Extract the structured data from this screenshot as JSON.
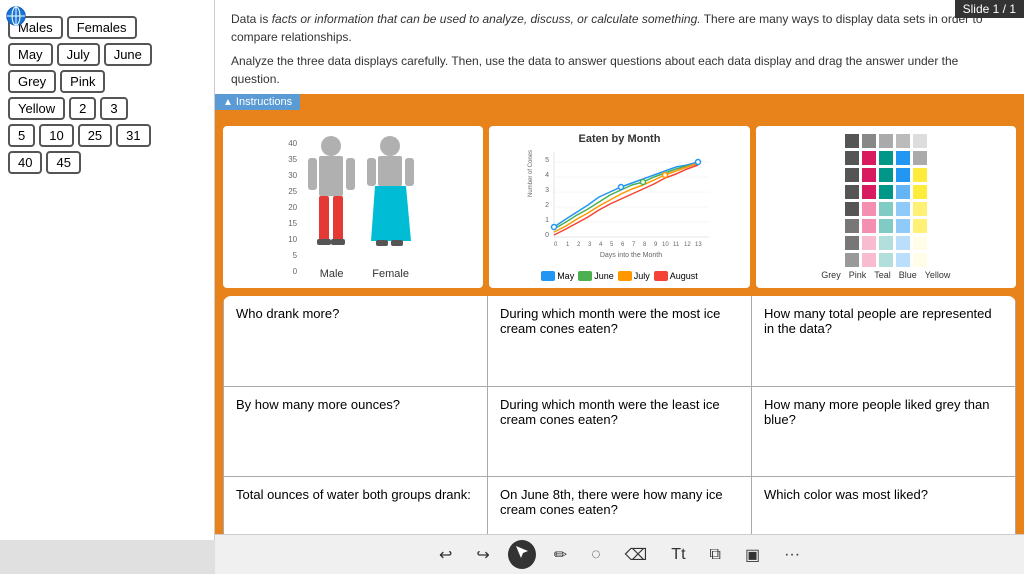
{
  "topBar": {
    "label": "Slide 1 / 1"
  },
  "sidebar": {
    "tokens": [
      [
        "Males",
        "Females"
      ],
      [
        "May",
        "July",
        "June"
      ],
      [
        "Grey",
        "Pink"
      ],
      [
        "Yellow",
        "2",
        "3"
      ],
      [
        "5",
        "10",
        "25",
        "31"
      ],
      [
        "40",
        "45"
      ]
    ]
  },
  "instructions": {
    "line1_prefix": "Data is ",
    "line1_italic": "facts or information that can be used to analyze, discuss, or calculate something.",
    "line1_suffix": " There are many ways to display data sets in order to compare relationships.",
    "line2": "Analyze the three data displays carefully. Then, use the data to answer questions about each data display and drag the answer under the question.",
    "btn_label": "Instructions"
  },
  "chartTitle": "Eaten by Month",
  "bodyChart": {
    "male_label": "Male",
    "female_label": "Female",
    "scale": [
      "40",
      "35",
      "30",
      "25",
      "20",
      "15",
      "10",
      "5",
      "0"
    ]
  },
  "lineChart": {
    "xLabel": "Days into the Month",
    "yLabel": "Number of Cones",
    "legend": [
      {
        "label": "May",
        "color": "#2196F3"
      },
      {
        "label": "June",
        "color": "#4CAF50"
      },
      {
        "label": "July",
        "color": "#FF9800"
      },
      {
        "label": "August",
        "color": "#F44336"
      }
    ]
  },
  "colorGrid": {
    "labels": [
      "Grey",
      "Pink",
      "Teal",
      "Blue",
      "Yellow"
    ],
    "colors": [
      "#888",
      "#E91E8C",
      "#009688",
      "#2196F3",
      "#FFEB3B"
    ]
  },
  "questions": [
    [
      "Who drank more?",
      "During which month were the most ice cream cones eaten?",
      "How many total people are represented in the data?"
    ],
    [
      "By how many more ounces?",
      "During which month were the least ice cream cones eaten?",
      "How many more people liked grey than blue?"
    ],
    [
      "Total ounces of water both groups drank:",
      "On June 8th, there were how many ice cream cones eaten?",
      "Which color was most liked?"
    ]
  ],
  "toolbar": {
    "undo": "↩",
    "redo": "↪",
    "arrow": "➤",
    "pen": "✏",
    "highlight": "◌",
    "eraser": "⌫",
    "text": "Tt",
    "copy": "⧉",
    "image": "▣",
    "more": "···"
  }
}
